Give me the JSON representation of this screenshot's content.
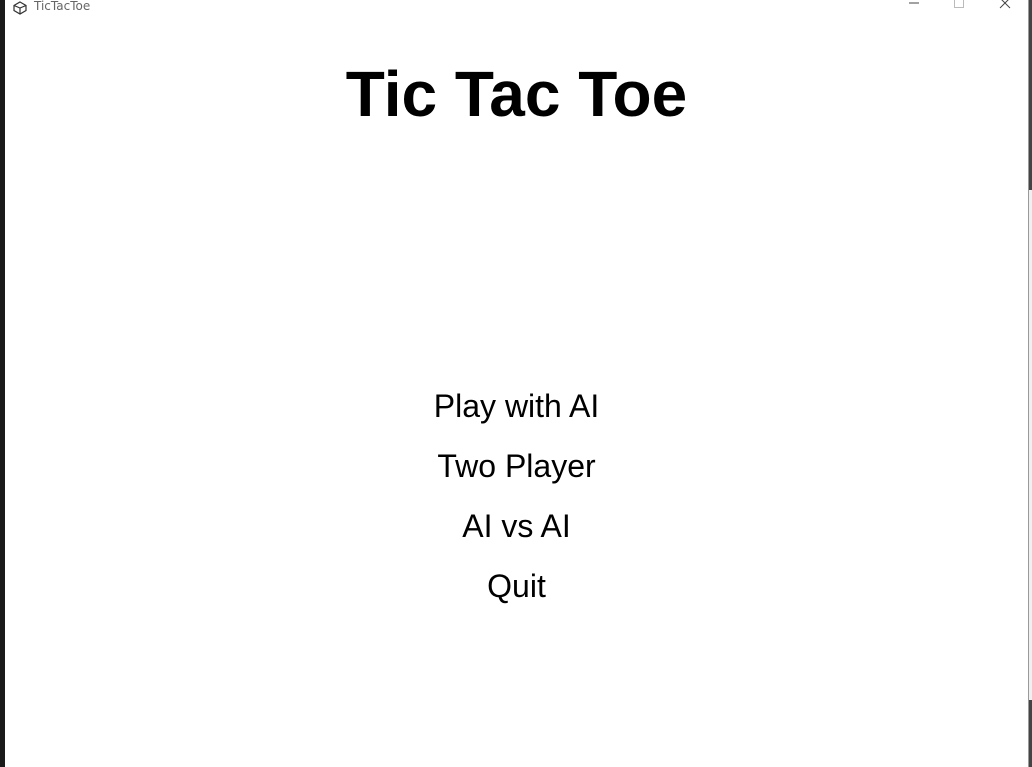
{
  "window": {
    "title": "TicTacToe",
    "icon": "unity-logo-icon",
    "controls": [
      "minimize-icon",
      "maximize-icon",
      "close-icon"
    ]
  },
  "game": {
    "title": "Tic Tac Toe"
  },
  "menu": {
    "items": [
      {
        "label": "Play with AI"
      },
      {
        "label": "Two Player"
      },
      {
        "label": "AI vs AI"
      },
      {
        "label": "Quit"
      }
    ]
  },
  "colors": {
    "background": "#ffffff",
    "text": "#000000",
    "title_bar_text": "#666666"
  }
}
